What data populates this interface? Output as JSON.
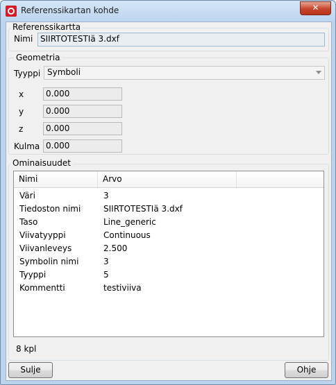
{
  "window": {
    "title": "Referenssikartan kohde",
    "close_glyph": "✕"
  },
  "reference": {
    "group_label": "Referenssikartta",
    "name_label": "Nimi",
    "name_value": "SIIRTOTESTIä 3.dxf"
  },
  "geometry": {
    "group_label": "Geometria",
    "type_label": "Tyyppi",
    "type_value": "Symboli",
    "fields": [
      {
        "label": "x",
        "value": "0.000"
      },
      {
        "label": "y",
        "value": "0.000"
      },
      {
        "label": "z",
        "value": "0.000"
      },
      {
        "label": "Kulma",
        "value": "0.000"
      }
    ]
  },
  "properties": {
    "group_label": "Ominaisuudet",
    "columns": [
      "Nimi",
      "Arvo"
    ],
    "rows": [
      {
        "name": "Väri",
        "value": "3"
      },
      {
        "name": "Tiedoston nimi",
        "value": "SIIRTOTESTIä 3.dxf"
      },
      {
        "name": "Taso",
        "value": "Line_generic"
      },
      {
        "name": "Viivatyyppi",
        "value": "Continuous"
      },
      {
        "name": "Viivanleveys",
        "value": "2.500"
      },
      {
        "name": "Symbolin nimi",
        "value": "3"
      },
      {
        "name": "Tyyppi",
        "value": "5"
      },
      {
        "name": "Kommentti",
        "value": "testiviiva"
      }
    ],
    "count": "8 kpl"
  },
  "buttons": {
    "close": "Sulje",
    "help": "Ohje"
  }
}
